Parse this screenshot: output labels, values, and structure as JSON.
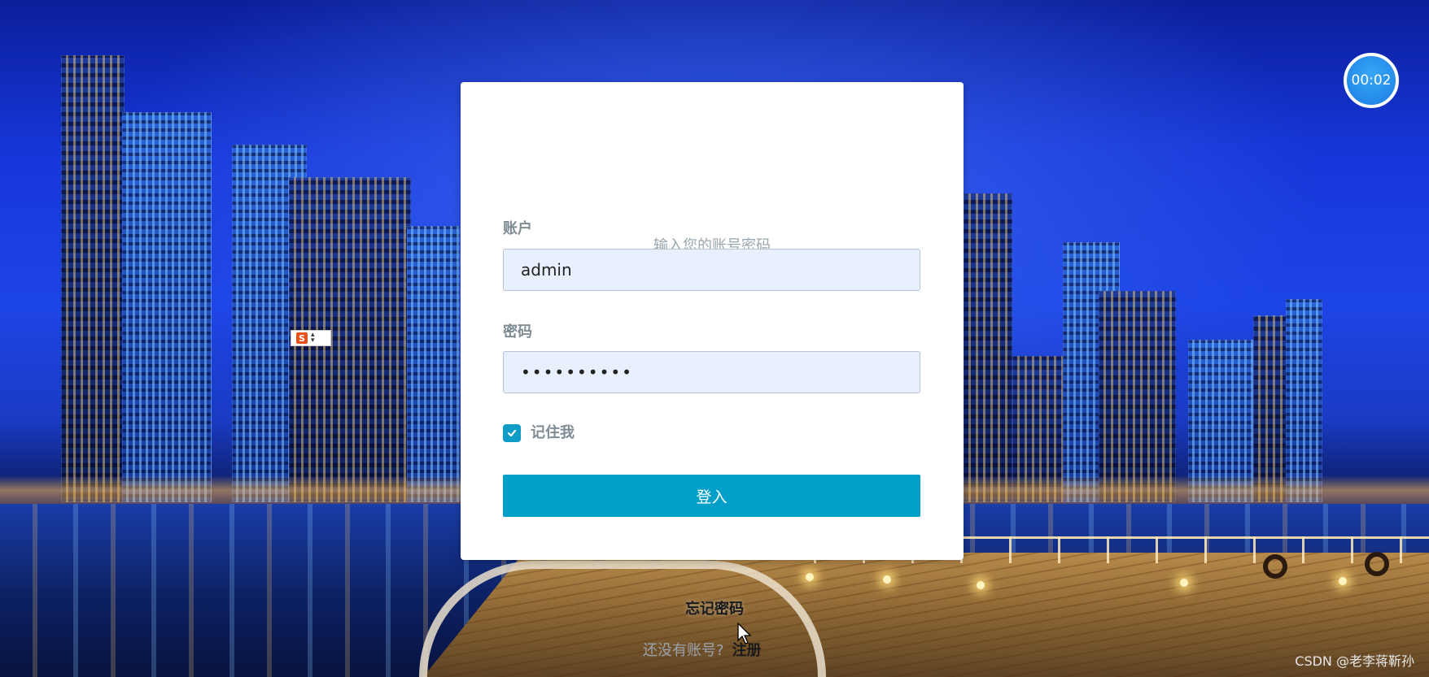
{
  "login": {
    "subtitle": "输入您的账号密码",
    "account_label": "账户",
    "account_value": "admin",
    "password_label": "密码",
    "password_value": "••••••••••",
    "remember_label": "记住我",
    "remember_checked": true,
    "login_button": "登入"
  },
  "links": {
    "forgot_password": "忘记密码",
    "no_account_text": "还没有账号?",
    "register": "注册"
  },
  "timer": {
    "value": "00:02"
  },
  "ime": {
    "icon": "S"
  },
  "watermark": "CSDN @老李蒋靳孙",
  "colors": {
    "primary": "#029fc9",
    "input_bg": "#e8f0fe",
    "label": "#7f8c94",
    "timer": "#1a7ee6"
  }
}
